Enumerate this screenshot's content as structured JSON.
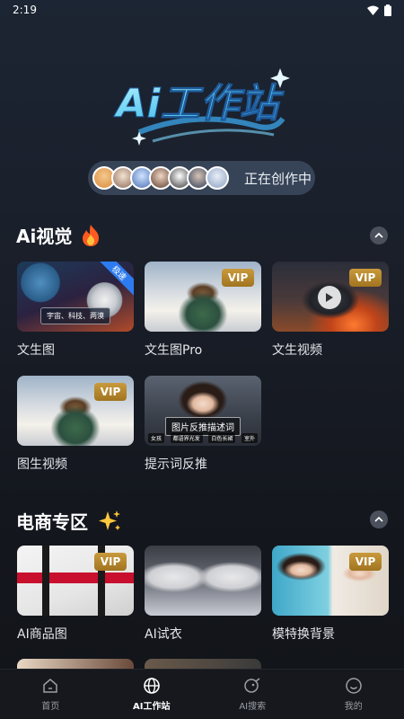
{
  "status": {
    "time": "2:19"
  },
  "logo": {
    "text": "Ai工作站"
  },
  "creators": {
    "text": "正在创作中"
  },
  "sections": {
    "visual": {
      "title": "Ai视觉",
      "items": [
        {
          "label": "文生图",
          "badge": "极速",
          "caption": "宇宙、科技、两漠"
        },
        {
          "label": "文生图Pro",
          "badge": "VIP"
        },
        {
          "label": "文生视频",
          "badge": "VIP"
        },
        {
          "label": "图生视频",
          "badge": "VIP"
        },
        {
          "label": "提示词反推",
          "caption": "图片反推描述词",
          "chips": [
            "女孩",
            "都语界光发",
            "白色长裙",
            "室外"
          ]
        }
      ]
    },
    "ecommerce": {
      "title": "电商专区",
      "items": [
        {
          "label": "AI商品图",
          "badge": "VIP"
        },
        {
          "label": "AI试衣"
        },
        {
          "label": "模特换背景",
          "badge": "VIP"
        }
      ]
    }
  },
  "tabbar": {
    "tabs": [
      {
        "label": "首页",
        "icon": "home-icon"
      },
      {
        "label": "AI工作站",
        "icon": "globe-icon"
      },
      {
        "label": "AI搜索",
        "icon": "search-icon"
      },
      {
        "label": "我的",
        "icon": "smile-icon"
      }
    ],
    "active": 1
  }
}
